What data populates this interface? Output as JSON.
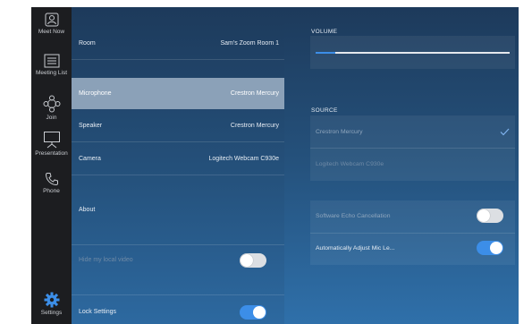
{
  "nav": {
    "items": [
      {
        "label": "Meet Now",
        "icon": "meet-now-icon"
      },
      {
        "label": "Meeting List",
        "icon": "meeting-list-icon"
      },
      {
        "label": "Join",
        "icon": "join-icon"
      },
      {
        "label": "Presentation",
        "icon": "presentation-icon"
      },
      {
        "label": "Phone",
        "icon": "phone-icon"
      },
      {
        "label": "Settings",
        "icon": "gear-icon"
      }
    ]
  },
  "settings": {
    "room": {
      "label": "Room",
      "value": "Sam's Zoom Room 1"
    },
    "microphone": {
      "label": "Microphone",
      "value": "Crestron Mercury"
    },
    "speaker": {
      "label": "Speaker",
      "value": "Crestron Mercury"
    },
    "camera": {
      "label": "Camera",
      "value": "Logitech Webcam C930e"
    },
    "about": {
      "label": "About"
    },
    "hide_local_video": {
      "label": "Hide my local video",
      "enabled": false
    },
    "lock_settings": {
      "label": "Lock Settings",
      "enabled": true
    }
  },
  "panel": {
    "volume": {
      "title": "VOLUME",
      "level": 0.1
    },
    "source": {
      "title": "SOURCE",
      "options": [
        {
          "label": "Crestron Mercury",
          "selected": true
        },
        {
          "label": "Logitech Webcam C930e",
          "selected": false
        }
      ]
    },
    "software_echo": {
      "label": "Software Echo Cancellation",
      "enabled": false
    },
    "auto_adjust_mic": {
      "label": "Automatically Adjust Mic Le...",
      "enabled": true
    }
  },
  "colors": {
    "accent": "#3c8ee8",
    "rail": "#1c1d20",
    "selected_row": "#8ba1b8"
  }
}
